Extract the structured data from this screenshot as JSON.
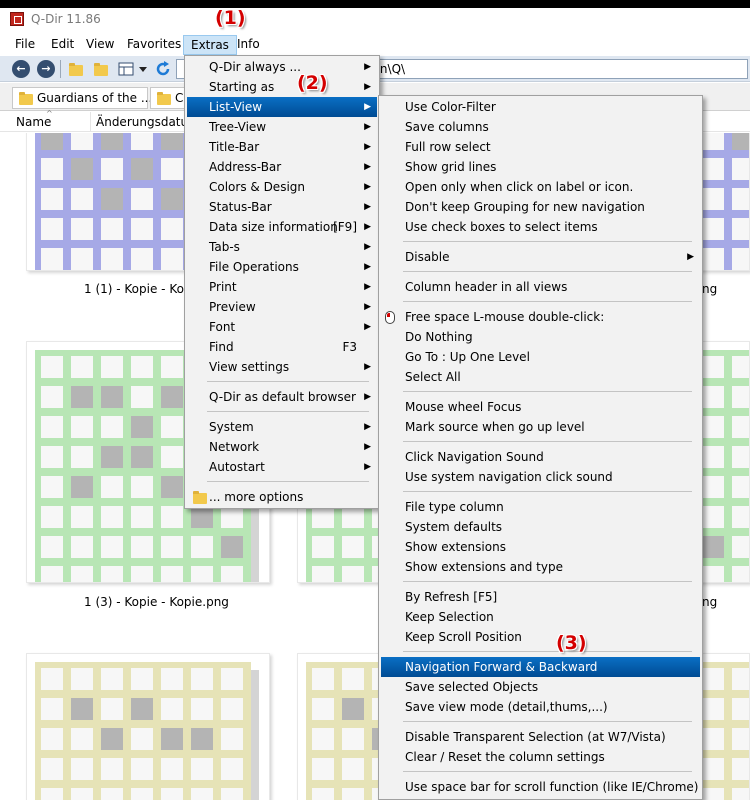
{
  "window": {
    "title": "Q-Dir 11.86"
  },
  "menubar": [
    "File",
    "Edit",
    "View",
    "Favorites",
    "Extras",
    "Info"
  ],
  "toolbar": {
    "address": "g\\icon\\Q\\"
  },
  "tabs": [
    "Guardians of the ...",
    "C"
  ],
  "columns": [
    "Name",
    "Änderungsdatum"
  ],
  "thumbnails": {
    "captions": [
      "1 (1) - Kopie - Kopi",
      "ng",
      "1 (3) - Kopie - Kopie.png",
      "ng"
    ],
    "colors": {
      "blue": "#a6a9e6",
      "green": "#b8e6b5",
      "yellow": "#e6e3b7",
      "gray": "#b4b4b4"
    }
  },
  "extras_menu": [
    {
      "label": "Q-Dir always ...",
      "arrow": true
    },
    {
      "label": "Starting as",
      "arrow": true
    },
    {
      "label": "List-View",
      "arrow": true,
      "highlight": true
    },
    {
      "label": "Tree-View",
      "arrow": true
    },
    {
      "label": "Title-Bar",
      "arrow": true
    },
    {
      "label": "Address-Bar",
      "arrow": true
    },
    {
      "label": "Colors & Design",
      "arrow": true
    },
    {
      "label": "Status-Bar",
      "arrow": true
    },
    {
      "label": "Data size information",
      "shortcut": "[F9]",
      "arrow": true
    },
    {
      "label": "Tab-s",
      "arrow": true
    },
    {
      "label": "File Operations",
      "arrow": true
    },
    {
      "label": "Print",
      "arrow": true
    },
    {
      "label": "Preview",
      "arrow": true
    },
    {
      "label": "Font",
      "arrow": true
    },
    {
      "label": "Find",
      "shortcut": "F3"
    },
    {
      "label": "View settings",
      "arrow": true
    },
    {
      "separator": true
    },
    {
      "label": "Q-Dir as default browser",
      "arrow": true
    },
    {
      "separator": true
    },
    {
      "label": "System",
      "arrow": true
    },
    {
      "label": "Network",
      "arrow": true
    },
    {
      "label": "Autostart",
      "arrow": true
    },
    {
      "separator": true
    },
    {
      "label": "... more options",
      "folder": true
    }
  ],
  "listview_menu": [
    {
      "label": "Use Color-Filter"
    },
    {
      "label": "Save columns"
    },
    {
      "label": "Full row select"
    },
    {
      "label": "Show grid lines"
    },
    {
      "label": "Open only when click on label or icon."
    },
    {
      "label": "Don't keep Grouping for new navigation"
    },
    {
      "label": "Use check boxes to select items"
    },
    {
      "separator": true
    },
    {
      "label": "Disable",
      "arrow": true
    },
    {
      "separator": true
    },
    {
      "label": "Column header in all views"
    },
    {
      "separator": true
    },
    {
      "label": "Free space L-mouse double-click:",
      "mouse": true
    },
    {
      "label": "Do Nothing"
    },
    {
      "label": "Go To : Up One Level"
    },
    {
      "label": "Select All"
    },
    {
      "separator": true
    },
    {
      "label": "Mouse wheel Focus"
    },
    {
      "label": "Mark source when go up level"
    },
    {
      "separator": true
    },
    {
      "label": "Click Navigation Sound"
    },
    {
      "label": "Use system navigation click sound"
    },
    {
      "separator": true
    },
    {
      "label": "File type column"
    },
    {
      "label": "System defaults"
    },
    {
      "label": "Show extensions"
    },
    {
      "label": "Show extensions and type"
    },
    {
      "separator": true
    },
    {
      "label": "By Refresh [F5]"
    },
    {
      "label": "Keep Selection"
    },
    {
      "label": "Keep Scroll Position"
    },
    {
      "separator": true
    },
    {
      "label": "Navigation Forward & Backward",
      "highlight": true
    },
    {
      "label": "Save selected Objects"
    },
    {
      "label": "Save view mode (detail,thums,...)"
    },
    {
      "separator": true
    },
    {
      "label": "Disable Transparent Selection (at W7/Vista)"
    },
    {
      "label": "Clear / Reset the column settings"
    },
    {
      "separator": true
    },
    {
      "label": "Use space bar for scroll function (like IE/Chrome)"
    }
  ],
  "annotations": [
    "(1)",
    "(2)",
    "(3)"
  ]
}
